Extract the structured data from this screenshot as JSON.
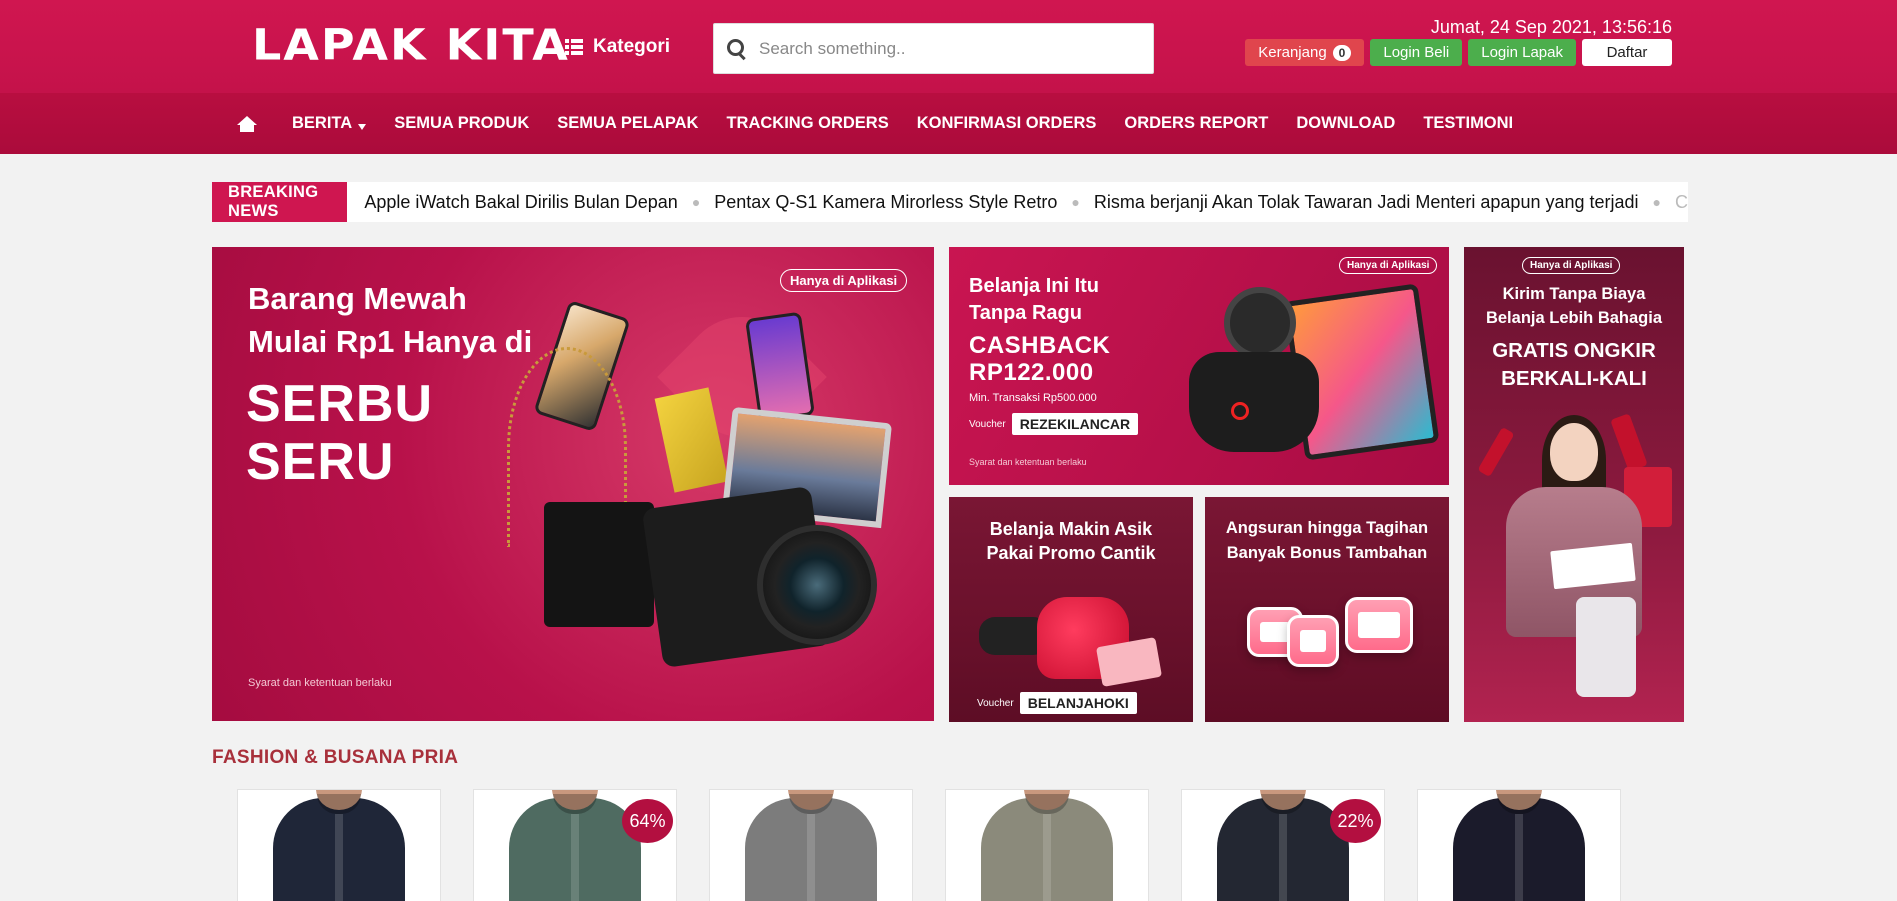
{
  "header": {
    "logo": "LAPAK KITA",
    "kategori_label": "Kategori",
    "search_placeholder": "Search something..",
    "datetime": "Jumat, 24 Sep 2021, 13:56:16",
    "cart_label": "Keranjang",
    "cart_count": "0",
    "login_beli": "Login Beli",
    "login_lapak": "Login Lapak",
    "daftar": "Daftar"
  },
  "nav": {
    "items": [
      {
        "label": "BERITA",
        "dropdown": true
      },
      {
        "label": "SEMUA PRODUK"
      },
      {
        "label": "SEMUA PELAPAK"
      },
      {
        "label": "TRACKING ORDERS"
      },
      {
        "label": "KONFIRMASI ORDERS"
      },
      {
        "label": "ORDERS REPORT"
      },
      {
        "label": "DOWNLOAD"
      },
      {
        "label": "TESTIMONI"
      }
    ]
  },
  "breaking": {
    "label": "BREAKING NEWS",
    "items": [
      "Apple iWatch Bakal Dirilis Bulan Depan",
      "Pentax Q-S1 Kamera Mirorless Style Retro",
      "Risma berjanji Akan Tolak Tawaran Jadi Menteri apapun yang terjadi",
      "C"
    ]
  },
  "banners": {
    "main": {
      "pill": "Hanya di Aplikasi",
      "line1": "Barang Mewah",
      "line2": "Mulai Rp1 Hanya di",
      "big1": "SERBU",
      "big2": "SERU",
      "fine": "Syarat dan ketentuan berlaku"
    },
    "cashback": {
      "pill": "Hanya di Aplikasi",
      "line1": "Belanja Ini Itu",
      "line2": "Tanpa Ragu",
      "big1": "CASHBACK",
      "big2": "RP122.000",
      "min": "Min. Transaksi Rp500.000",
      "voucher_label": "Voucher",
      "voucher_code": "REZEKILANCAR",
      "fine": "Syarat dan ketentuan berlaku"
    },
    "promo": {
      "line1": "Belanja Makin Asik",
      "line2": "Pakai Promo Cantik",
      "voucher_label": "Voucher",
      "voucher_code": "BELANJAHOKI"
    },
    "angsuran": {
      "line1": "Angsuran hingga Tagihan",
      "line2": "Banyak Bonus Tambahan"
    },
    "ongkir": {
      "pill": "Hanya di Aplikasi",
      "line1": "Kirim Tanpa Biaya",
      "line2": "Belanja Lebih Bahagia",
      "big1": "GRATIS ONGKIR",
      "big2": "BERKALI-KALI"
    }
  },
  "section": {
    "title": "FASHION & BUSANA PRIA",
    "products": [
      {
        "color": "#1f2638",
        "discount": ""
      },
      {
        "color": "#4f6b61",
        "discount": "64%"
      },
      {
        "color": "#7c7c7c",
        "discount": ""
      },
      {
        "color": "#8b8a7b",
        "discount": ""
      },
      {
        "color": "#232732",
        "discount": "22%"
      },
      {
        "color": "#1b1b2b",
        "discount": ""
      }
    ]
  }
}
